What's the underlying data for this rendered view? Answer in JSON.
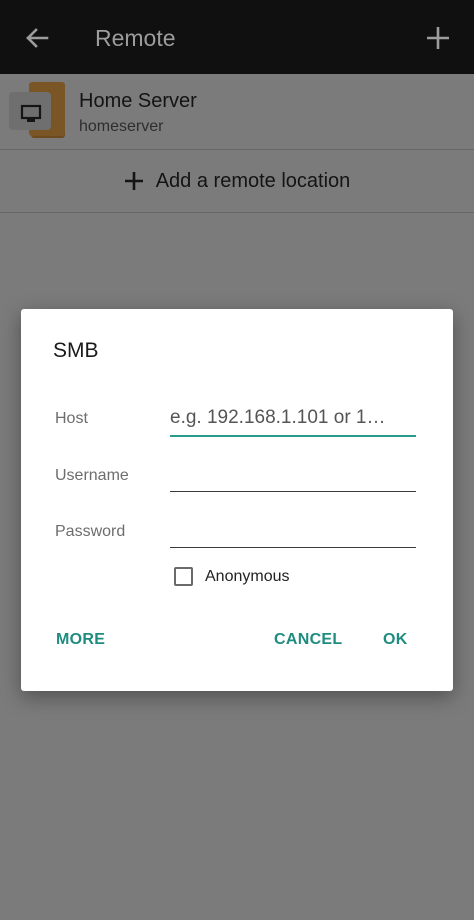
{
  "toolbar": {
    "title": "Remote",
    "back_icon": "arrow-left-icon",
    "add_icon": "plus-icon"
  },
  "list": {
    "server": {
      "name": "Home Server",
      "subtitle": "homeserver",
      "icon": "server-monitor-icon"
    },
    "add_location_label": "Add a remote location"
  },
  "dialog": {
    "title": "SMB",
    "host": {
      "label": "Host",
      "placeholder": "e.g. 192.168.1.101 or 1…",
      "value": ""
    },
    "username": {
      "label": "Username",
      "value": ""
    },
    "password": {
      "label": "Password",
      "value": ""
    },
    "anonymous": {
      "label": "Anonymous",
      "checked": false
    },
    "buttons": {
      "more": "MORE",
      "cancel": "CANCEL",
      "ok": "OK"
    }
  },
  "colors": {
    "accent": "#1f8c80",
    "toolbar_bg": "#101010",
    "scrim_bg": "#7b7b7b"
  }
}
